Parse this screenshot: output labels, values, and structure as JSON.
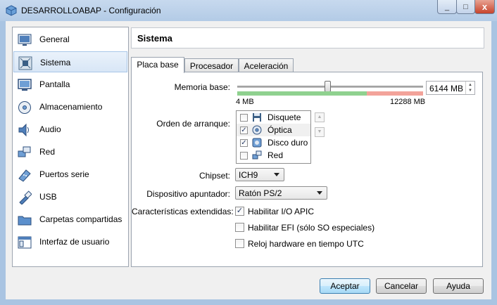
{
  "window": {
    "title": "DESARROLLOABAP - Configuración",
    "minimize": "_",
    "maximize": "□",
    "close": "x"
  },
  "sidebar": {
    "items": [
      {
        "label": "General",
        "icon": "monitor-icon"
      },
      {
        "label": "Sistema",
        "icon": "motherboard-icon",
        "selected": true
      },
      {
        "label": "Pantalla",
        "icon": "display-icon"
      },
      {
        "label": "Almacenamiento",
        "icon": "disk-icon"
      },
      {
        "label": "Audio",
        "icon": "speaker-icon"
      },
      {
        "label": "Red",
        "icon": "network-icon"
      },
      {
        "label": "Puertos serie",
        "icon": "serial-port-icon"
      },
      {
        "label": "USB",
        "icon": "usb-icon"
      },
      {
        "label": "Carpetas compartidas",
        "icon": "folder-icon"
      },
      {
        "label": "Interfaz de usuario",
        "icon": "window-icon"
      }
    ]
  },
  "section": {
    "title": "Sistema"
  },
  "tabs": [
    {
      "label": "Placa base",
      "active": true
    },
    {
      "label": "Procesador"
    },
    {
      "label": "Aceleración"
    }
  ],
  "memory": {
    "label": "Memoria base:",
    "value": "6144 MB",
    "min_label": "4 MB",
    "max_label": "12288 MB",
    "value_mb": 6144,
    "min_mb": 4,
    "max_mb": 12288
  },
  "boot": {
    "label": "Orden de arranque:",
    "items": [
      {
        "label": "Disquete",
        "checked": false,
        "icon": "floppy-icon"
      },
      {
        "label": "Óptica",
        "checked": true,
        "icon": "optical-disc-icon",
        "selected": true
      },
      {
        "label": "Disco duro",
        "checked": true,
        "icon": "hard-disk-icon"
      },
      {
        "label": "Red",
        "checked": false,
        "icon": "network-icon"
      }
    ]
  },
  "chipset": {
    "label": "Chipset:",
    "value": "ICH9"
  },
  "pointing": {
    "label": "Dispositivo apuntador:",
    "value": "Ratón PS/2"
  },
  "extended": {
    "label": "Características extendidas:",
    "options": [
      {
        "label": "Habilitar I/O APIC",
        "checked": true
      },
      {
        "label": "Habilitar EFI (sólo SO especiales)",
        "checked": false
      },
      {
        "label": "Reloj hardware en tiempo UTC",
        "checked": false
      }
    ]
  },
  "buttons": {
    "accept": "Aceptar",
    "cancel": "Cancelar",
    "help": "Ayuda"
  },
  "colors": {
    "slider_green": "#8fd18f",
    "slider_red": "#f3a39a",
    "selection": "#d8e6f6"
  }
}
